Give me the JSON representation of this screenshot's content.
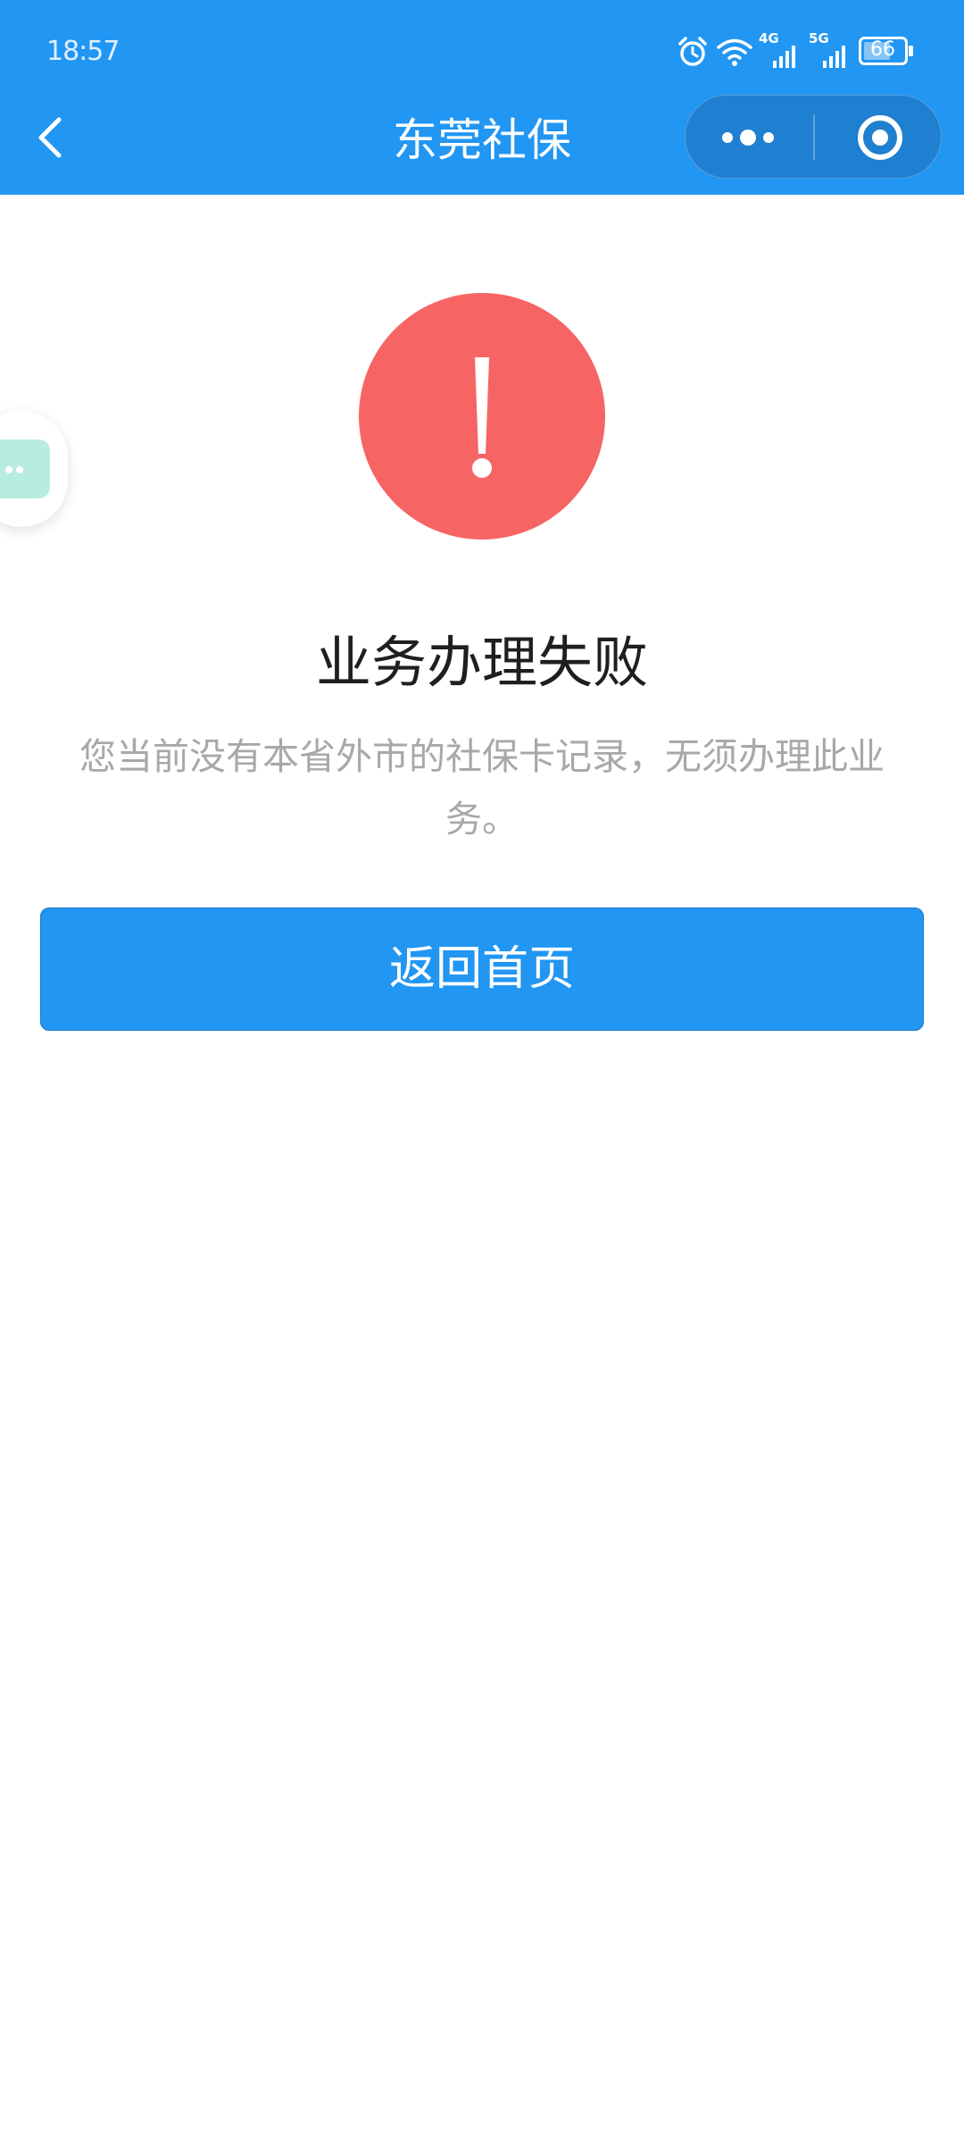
{
  "status_bar": {
    "time": "18:57",
    "signal_1_label": "4G",
    "signal_2_label": "5G",
    "battery": "66",
    "icons": [
      "alarm-icon",
      "wifi-icon",
      "signal-4g-icon",
      "signal-5g-icon",
      "battery-icon"
    ]
  },
  "nav": {
    "title": "东莞社保",
    "back_icon": "chevron-left-icon",
    "more_icon": "more-dots-icon",
    "close_icon": "target-circle-icon"
  },
  "result": {
    "icon": "exclamation-icon",
    "title": "业务办理失败",
    "description": "您当前没有本省外市的社保卡记录，无须办理此业务。"
  },
  "actions": {
    "home_button": "返回首页"
  },
  "colors": {
    "primary": "#2196f3",
    "error": "#f76464",
    "title_text": "#1f1f1f",
    "desc_text": "#a8a8a8",
    "floating_bubble": "#b8ece0"
  }
}
